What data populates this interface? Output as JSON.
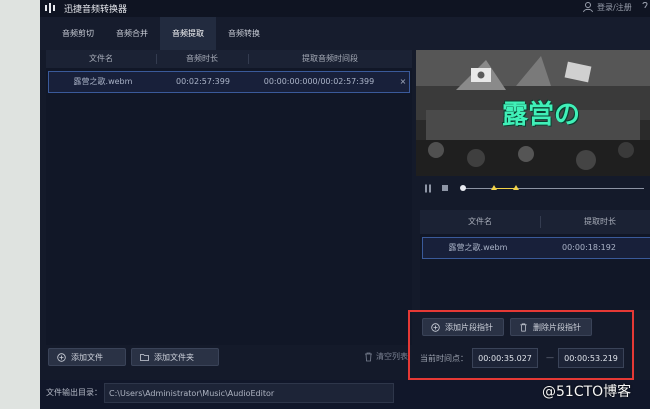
{
  "app": {
    "title": "迅捷音频转换器"
  },
  "header": {
    "login": "登录/注册"
  },
  "tabs": [
    {
      "label": "音频剪切",
      "active": false
    },
    {
      "label": "音频合并",
      "active": false
    },
    {
      "label": "音频提取",
      "active": true
    },
    {
      "label": "音频转换",
      "active": false
    }
  ],
  "file_table": {
    "columns": [
      "文件名",
      "音频时长",
      "提取音频时间段"
    ],
    "rows": [
      {
        "name": "露营之歌.webm",
        "duration": "00:02:57:399",
        "range": "00:00:00:000/00:02:57:399",
        "close": "×"
      }
    ]
  },
  "buttons": {
    "add_file": "添加文件",
    "add_folder": "添加文件夹",
    "clear_list": "清空列表",
    "add_marker": "添加片段指针",
    "delete_marker": "删除片段指针"
  },
  "output": {
    "label": "文件输出目录：",
    "path": "C:\\Users\\Administrator\\Music\\AudioEditor"
  },
  "video": {
    "overlay_text": "露営の"
  },
  "segment_table": {
    "columns": [
      "文件名",
      "提取时长"
    ],
    "rows": [
      {
        "name": "露营之歌.webm",
        "duration": "00:00:18:192"
      }
    ]
  },
  "time": {
    "label": "当前时间点：",
    "start": "00:00:35.027",
    "separator": "—",
    "end": "00:00:53.219"
  },
  "player": {
    "position": 0.0,
    "markers": [
      0.18,
      0.3
    ]
  },
  "watermark": "@51CTO博客",
  "colors": {
    "background": "#141a2a",
    "accent": "#3a5a9a",
    "highlight": "#e53935",
    "marker": "#f1d24a"
  }
}
